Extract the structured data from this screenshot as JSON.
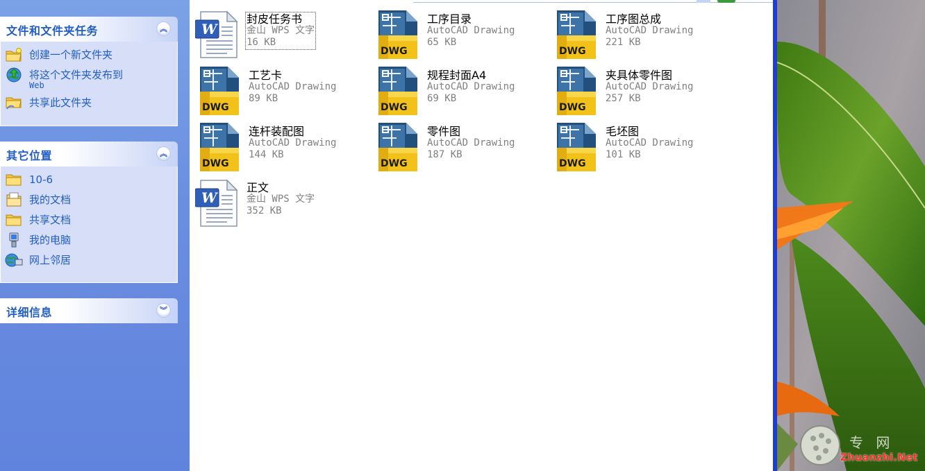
{
  "task_pane": {
    "groups": [
      {
        "title": "文件和文件夹任务",
        "collapse_glyph": "︽",
        "items": [
          {
            "label": "创建一个新文件夹",
            "icon": "new-folder-icon"
          },
          {
            "label": "将这个文件夹发布到",
            "sub": "Web",
            "icon": "publish-web-icon"
          },
          {
            "label": "共享此文件夹",
            "icon": "share-folder-icon"
          }
        ]
      },
      {
        "title": "其它位置",
        "collapse_glyph": "︽",
        "items": [
          {
            "label": "10-6",
            "icon": "folder-icon"
          },
          {
            "label": "我的文档",
            "icon": "my-documents-icon"
          },
          {
            "label": "共享文档",
            "icon": "shared-documents-icon"
          },
          {
            "label": "我的电脑",
            "icon": "my-computer-icon"
          },
          {
            "label": "网上邻居",
            "icon": "network-places-icon"
          }
        ]
      },
      {
        "title": "详细信息",
        "collapse_glyph": "︾"
      }
    ]
  },
  "files": [
    {
      "name": "封皮任务书",
      "type": "金山 WPS 文字",
      "size": "16 KB",
      "icon": "wps-doc-icon"
    },
    {
      "name": "工序目录",
      "type": "AutoCAD Drawing",
      "size": "65 KB",
      "icon": "dwg-icon"
    },
    {
      "name": "工序图总成",
      "type": "AutoCAD Drawing",
      "size": "221 KB",
      "icon": "dwg-icon"
    },
    {
      "name": "工艺卡",
      "type": "AutoCAD Drawing",
      "size": "89 KB",
      "icon": "dwg-icon"
    },
    {
      "name": "规程封面A4",
      "type": "AutoCAD Drawing",
      "size": "69 KB",
      "icon": "dwg-icon"
    },
    {
      "name": "夹具体零件图",
      "type": "AutoCAD Drawing",
      "size": "257 KB",
      "icon": "dwg-icon"
    },
    {
      "name": "连杆装配图",
      "type": "AutoCAD Drawing",
      "size": "144 KB",
      "icon": "dwg-icon"
    },
    {
      "name": "零件图",
      "type": "AutoCAD Drawing",
      "size": "187 KB",
      "icon": "dwg-icon"
    },
    {
      "name": "毛坯图",
      "type": "AutoCAD Drawing",
      "size": "101 KB",
      "icon": "dwg-icon"
    },
    {
      "name": "正文",
      "type": "金山 WPS 文字",
      "size": "352 KB",
      "icon": "wps-doc-icon"
    }
  ],
  "dwg_badge": "DWG",
  "wps_badge": "W",
  "watermark": {
    "cn": "专 网",
    "en": "Zhuanzhi.Net"
  },
  "colors": {
    "task_link": "#215dc6",
    "pane_bg": "#6a8ee0",
    "accent_blue": "#1d3cd8",
    "dwg_yellow": "#f2c21a",
    "dwg_blue": "#21507e"
  }
}
